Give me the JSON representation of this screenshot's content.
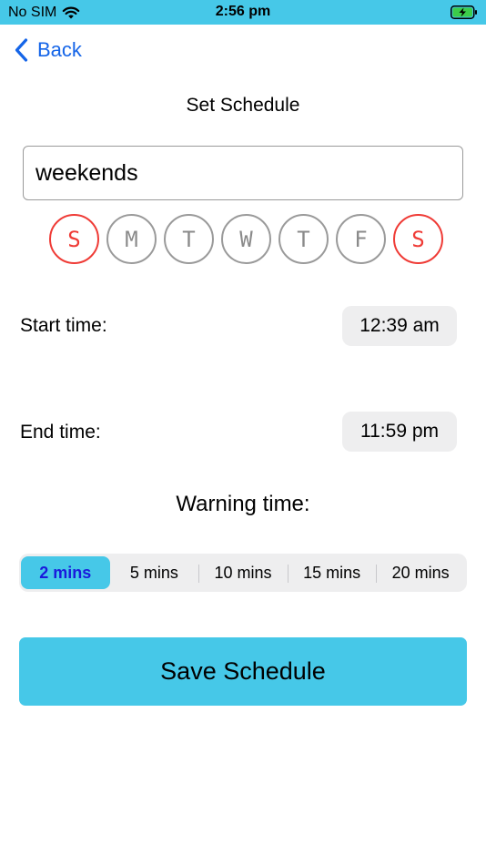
{
  "status_bar": {
    "carrier": "No SIM",
    "time": "2:56 pm",
    "wifi_icon": "wifi-icon",
    "battery_icon": "battery-charging-icon"
  },
  "nav": {
    "back_label": "Back",
    "back_icon": "chevron-left-icon"
  },
  "title": "Set Schedule",
  "schedule_name": {
    "value": "weekends"
  },
  "days": [
    {
      "letter": "S",
      "active": true
    },
    {
      "letter": "M",
      "active": false
    },
    {
      "letter": "T",
      "active": false
    },
    {
      "letter": "W",
      "active": false
    },
    {
      "letter": "T",
      "active": false
    },
    {
      "letter": "F",
      "active": false
    },
    {
      "letter": "S",
      "active": true
    }
  ],
  "start": {
    "label": "Start time:",
    "value": "12:39 am"
  },
  "end": {
    "label": "End time:",
    "value": "11:59 pm"
  },
  "warning": {
    "label": "Warning time:",
    "options": [
      "2 mins",
      "5 mins",
      "10 mins",
      "15 mins",
      "20 mins"
    ],
    "selected_index": 0
  },
  "save_label": "Save Schedule",
  "colors": {
    "accent": "#46c8e8",
    "active_day": "#ef3b36",
    "inactive_day": "#9a9a9a",
    "link": "#1565e8"
  }
}
